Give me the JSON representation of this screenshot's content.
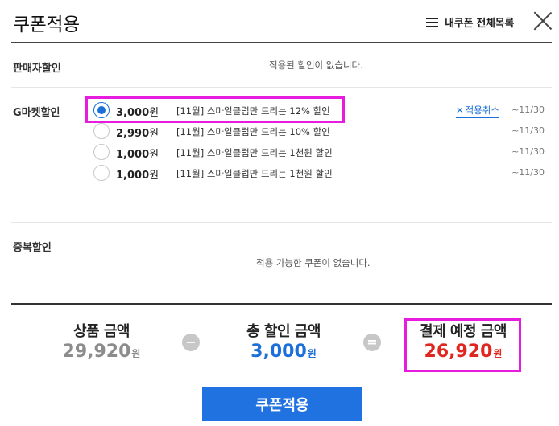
{
  "header": {
    "title": "쿠폰적용",
    "my_coupon_label": "내쿠폰 전체목록"
  },
  "seller_discount": {
    "label": "판매자할인",
    "empty_message": "적용된 할인이 없습니다."
  },
  "gmarket_discount": {
    "label": "G마켓할인",
    "cancel_label": "적용취소",
    "coupons": [
      {
        "amount": "3,000",
        "unit": "원",
        "desc": "[11월] 스마일클럽만 드리는 12% 할인",
        "expiry": "~11/30",
        "selected": true
      },
      {
        "amount": "2,990",
        "unit": "원",
        "desc": "[11월] 스마일클럽만 드리는 10% 할인",
        "expiry": "~11/30",
        "selected": false
      },
      {
        "amount": "1,000",
        "unit": "원",
        "desc": "[11월] 스마일클럽만 드리는 1천원 할인",
        "expiry": "~11/30",
        "selected": false
      },
      {
        "amount": "1,000",
        "unit": "원",
        "desc": "[11월] 스마일클럽만 드리는 1천원 할인",
        "expiry": "~11/30",
        "selected": false
      }
    ]
  },
  "duplicate_discount": {
    "label": "중복할인",
    "empty_message": "적용 가능한 쿠폰이 없습니다."
  },
  "summary": {
    "product_label": "상품 금액",
    "product_value": "29,920",
    "discount_label": "총 할인 금액",
    "discount_value": "3,000",
    "payment_label": "결제 예정 금액",
    "payment_value": "26,920",
    "unit": "원",
    "minus_symbol": "−",
    "equals_symbol": "=",
    "colors": {
      "product": "#8c8c8c",
      "discount": "#1a6fd8",
      "payment": "#e0271f"
    }
  },
  "apply_button_label": "쿠폰적용"
}
